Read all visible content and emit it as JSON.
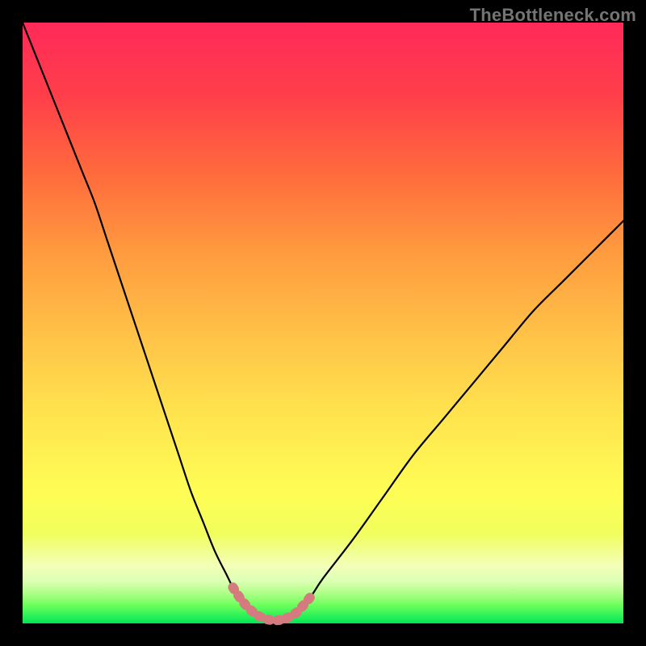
{
  "watermark": "TheBottleneck.com",
  "colors": {
    "curve": "#000000",
    "highlight": "#d57a7f",
    "background_black": "#000000"
  },
  "chart_data": {
    "type": "line",
    "title": "",
    "xlabel": "",
    "ylabel": "",
    "xlim": [
      0,
      100
    ],
    "ylim": [
      0,
      100
    ],
    "grid": false,
    "legend": false,
    "x": [
      0,
      2,
      4,
      6,
      8,
      10,
      12,
      14,
      16,
      18,
      20,
      22,
      24,
      26,
      28,
      30,
      32,
      34,
      35,
      36,
      37,
      38,
      39,
      40,
      41,
      42,
      43,
      44,
      45,
      46,
      48,
      50,
      55,
      60,
      65,
      70,
      75,
      80,
      85,
      90,
      95,
      100
    ],
    "values": [
      100,
      95,
      90,
      85,
      80,
      75,
      70,
      64,
      58,
      52,
      46,
      40,
      34,
      28,
      22,
      17,
      12,
      8,
      6,
      4.5,
      3.2,
      2.2,
      1.4,
      0.9,
      0.6,
      0.5,
      0.6,
      0.9,
      1.4,
      2.2,
      4.5,
      7.5,
      14,
      21,
      28,
      34,
      40,
      46,
      52,
      57,
      62,
      67
    ],
    "annotations": [
      {
        "kind": "highlight-span",
        "x_start": 35,
        "x_end": 48,
        "note": "valley region marked with thick light-red dotted overlay"
      }
    ]
  }
}
